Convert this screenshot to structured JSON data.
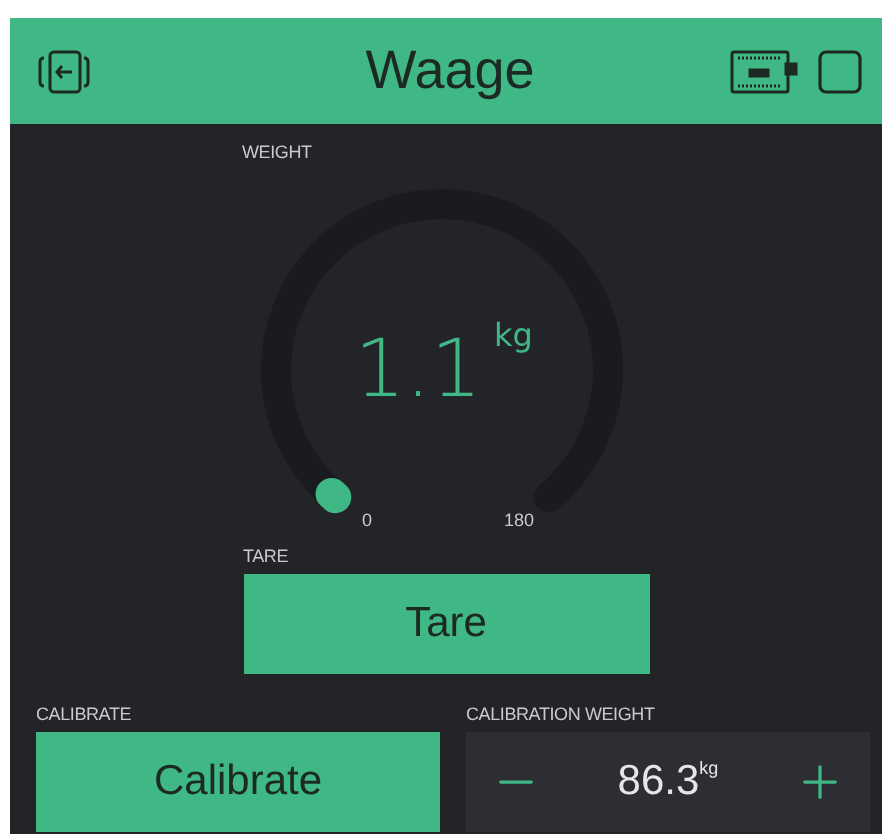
{
  "header": {
    "title": "Waage"
  },
  "gauge": {
    "label": "WEIGHT",
    "value": "1.1",
    "unit": "kg",
    "min": "0",
    "max": "180"
  },
  "tare": {
    "label": "TARE",
    "button": "Tare"
  },
  "calibrate": {
    "label": "CALIBRATE",
    "button": "Calibrate"
  },
  "calibration_weight": {
    "label": "CALIBRATION WEIGHT",
    "value": "86.3",
    "unit": "kg"
  }
}
